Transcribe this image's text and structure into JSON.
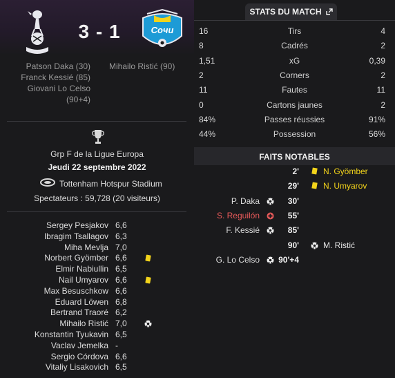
{
  "match": {
    "score": "3 - 1",
    "home_scorers": [
      "Patson Daka (30)",
      "Franck Kessié (85)",
      "Giovani Lo Celso",
      "(90+4)"
    ],
    "away_scorers": [
      "Mihailo Ristić (90)"
    ]
  },
  "info": {
    "competition": "Grp F de la Ligue Europa",
    "date": "Jeudi 22 septembre 2022",
    "stadium": "Tottenham Hotspur Stadium",
    "attendance": "Spectateurs : 59,728 (20 visiteurs)"
  },
  "lineup": [
    {
      "name": "Sergey Pesjakov",
      "rating": "6,6",
      "event": ""
    },
    {
      "name": "Ibragim Tsallagov",
      "rating": "6,3",
      "event": ""
    },
    {
      "name": "Miha Mevlja",
      "rating": "7,0",
      "event": ""
    },
    {
      "name": "Norbert Gyömber",
      "rating": "6,6",
      "event": "yellow"
    },
    {
      "name": "Elmir Nabiullin",
      "rating": "6,5",
      "event": ""
    },
    {
      "name": "Nail Umyarov",
      "rating": "6,6",
      "event": "yellow"
    },
    {
      "name": "Max Besuschkow",
      "rating": "6,6",
      "event": ""
    },
    {
      "name": "Eduard Löwen",
      "rating": "6,8",
      "event": ""
    },
    {
      "name": "Bertrand Traoré",
      "rating": "6,2",
      "event": ""
    },
    {
      "name": "Mihailo Ristić",
      "rating": "7,0",
      "event": "goal"
    },
    {
      "name": "Konstantin Tyukavin",
      "rating": "6,5",
      "event": ""
    },
    {
      "name": "Vaclav Jemelka",
      "rating": "-",
      "event": ""
    },
    {
      "name": "Sergio Córdova",
      "rating": "6,6",
      "event": ""
    },
    {
      "name": "Vitaliy Lisakovich",
      "rating": "6,5",
      "event": ""
    }
  ],
  "stats_tab": "STATS DU MATCH",
  "stats": [
    {
      "home": "16",
      "label": "Tirs",
      "away": "4"
    },
    {
      "home": "8",
      "label": "Cadrés",
      "away": "2"
    },
    {
      "home": "1,51",
      "label": "xG",
      "away": "0,39"
    },
    {
      "home": "2",
      "label": "Corners",
      "away": "2"
    },
    {
      "home": "11",
      "label": "Fautes",
      "away": "11"
    },
    {
      "home": "0",
      "label": "Cartons jaunes",
      "away": "2"
    },
    {
      "home": "84%",
      "label": "Passes réussies",
      "away": "91%"
    },
    {
      "home": "44%",
      "label": "Possession",
      "away": "56%"
    }
  ],
  "events_title": "FAITS NOTABLES",
  "events": [
    {
      "home": "",
      "minute": "2'",
      "away": "N. Gyömber",
      "type": "yellow",
      "side": "away"
    },
    {
      "home": "",
      "minute": "29'",
      "away": "N. Umyarov",
      "type": "yellow",
      "side": "away"
    },
    {
      "home": "P. Daka",
      "minute": "30'",
      "away": "",
      "type": "goal",
      "side": "home"
    },
    {
      "home": "S. Reguilón",
      "minute": "55'",
      "away": "",
      "type": "injury",
      "side": "home"
    },
    {
      "home": "F. Kessié",
      "minute": "85'",
      "away": "",
      "type": "goal",
      "side": "home"
    },
    {
      "home": "",
      "minute": "90'",
      "away": "M. Ristić",
      "type": "goal",
      "side": "away"
    },
    {
      "home": "G. Lo Celso",
      "minute": "90'+4",
      "away": "",
      "type": "goal",
      "side": "home"
    }
  ],
  "colors": {
    "yellow_card": "#f2d31b",
    "injury": "#e85a5a",
    "background": "#1a1a1c"
  }
}
